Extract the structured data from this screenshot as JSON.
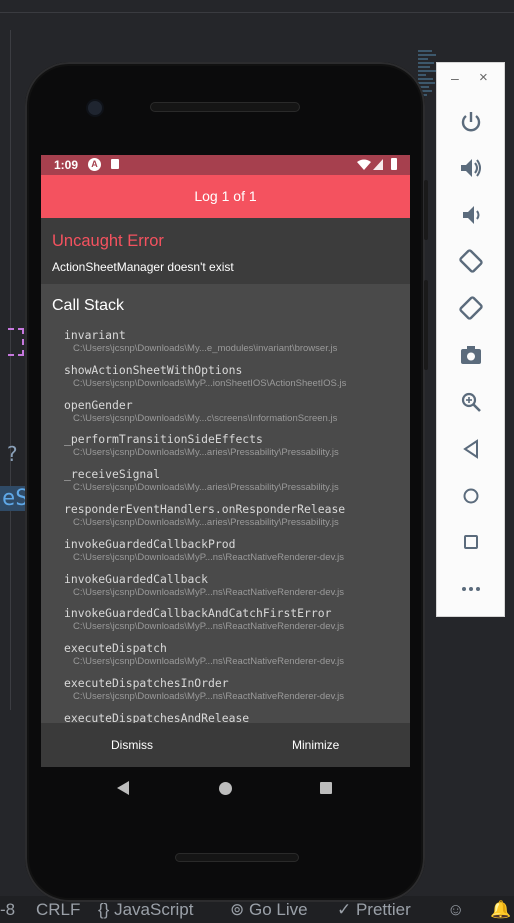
{
  "ide": {
    "status_items": [
      "-8",
      "CRLF",
      "{} JavaScript",
      "Go Live",
      "Prettier"
    ]
  },
  "emulator_panel": {
    "minimize_label": "–",
    "close_label": "×",
    "buttons": [
      "power-icon",
      "volume-up-icon",
      "volume-down-icon",
      "rotate-left-icon",
      "rotate-right-icon",
      "camera-icon",
      "zoom-icon",
      "back-icon",
      "home-icon",
      "overview-icon",
      "more-icon"
    ]
  },
  "status_bar": {
    "time": "1:09"
  },
  "log_header": "Log 1 of 1",
  "error": {
    "title": "Uncaught Error",
    "message": "ActionSheetManager doesn't exist"
  },
  "call_stack": {
    "title": "Call Stack",
    "frames": [
      {
        "fn": "invariant",
        "path": "C:\\Users\\jcsnp\\Downloads\\My...e_modules\\invariant\\browser.js"
      },
      {
        "fn": "showActionSheetWithOptions",
        "path": "C:\\Users\\jcsnp\\Downloads\\MyP...ionSheetIOS\\ActionSheetIOS.js"
      },
      {
        "fn": "openGender",
        "path": "C:\\Users\\jcsnp\\Downloads\\My...c\\screens\\InformationScreen.js"
      },
      {
        "fn": "_performTransitionSideEffects",
        "path": "C:\\Users\\jcsnp\\Downloads\\My...aries\\Pressability\\Pressability.js"
      },
      {
        "fn": "_receiveSignal",
        "path": "C:\\Users\\jcsnp\\Downloads\\My...aries\\Pressability\\Pressability.js"
      },
      {
        "fn": "responderEventHandlers.onResponderRelease",
        "path": "C:\\Users\\jcsnp\\Downloads\\My...aries\\Pressability\\Pressability.js"
      },
      {
        "fn": "invokeGuardedCallbackProd",
        "path": "C:\\Users\\jcsnp\\Downloads\\MyP...ns\\ReactNativeRenderer-dev.js"
      },
      {
        "fn": "invokeGuardedCallback",
        "path": "C:\\Users\\jcsnp\\Downloads\\MyP...ns\\ReactNativeRenderer-dev.js"
      },
      {
        "fn": "invokeGuardedCallbackAndCatchFirstError",
        "path": "C:\\Users\\jcsnp\\Downloads\\MyP...ns\\ReactNativeRenderer-dev.js"
      },
      {
        "fn": "executeDispatch",
        "path": "C:\\Users\\jcsnp\\Downloads\\MyP...ns\\ReactNativeRenderer-dev.js"
      },
      {
        "fn": "executeDispatchesInOrder",
        "path": "C:\\Users\\jcsnp\\Downloads\\MyP...ns\\ReactNativeRenderer-dev.js"
      },
      {
        "fn": "executeDispatchesAndRelease",
        "path": ""
      }
    ]
  },
  "actions": {
    "dismiss": "Dismiss",
    "minimize": "Minimize"
  },
  "colors": {
    "header": "#f4525f",
    "status_bar": "#a6404e",
    "error_title": "#f4525f"
  }
}
